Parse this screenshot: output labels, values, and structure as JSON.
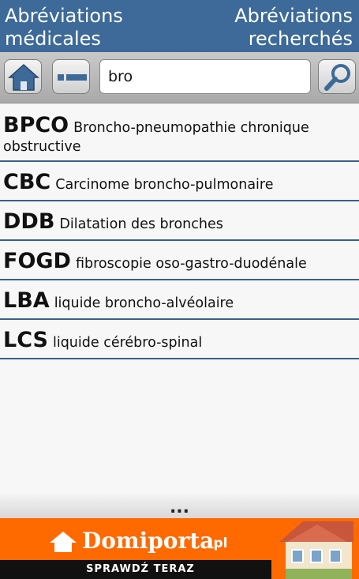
{
  "header": {
    "left_line1": "Abréviations",
    "left_line2": "médicales",
    "right_line1": "Abréviations",
    "right_line2": "recherchés"
  },
  "toolbar": {
    "home_icon": "home-icon",
    "minus_icon": "minus-icon",
    "search_icon": "magnifier-icon",
    "search_value": "bro",
    "accent": "#3d6a98"
  },
  "results": [
    {
      "abbr": "BPCO",
      "definition": "Broncho-pneumopathie chronique obstructive"
    },
    {
      "abbr": "CBC",
      "definition": "Carcinome broncho-pulmonaire"
    },
    {
      "abbr": "DDB",
      "definition": "Dilatation des bronches"
    },
    {
      "abbr": "FOGD",
      "definition": "fibroscopie oso-gastro-duodénale"
    },
    {
      "abbr": "LBA",
      "definition": "liquide broncho-alvéolaire"
    },
    {
      "abbr": "LCS",
      "definition": "liquide cérébro-spinal"
    }
  ],
  "footer": {
    "more": "...",
    "ad_brand": "Domiporta",
    "ad_suffix": ".pl",
    "ad_cta": "SPRAWDŹ TERAZ",
    "ad_color": "#ff6a00"
  }
}
